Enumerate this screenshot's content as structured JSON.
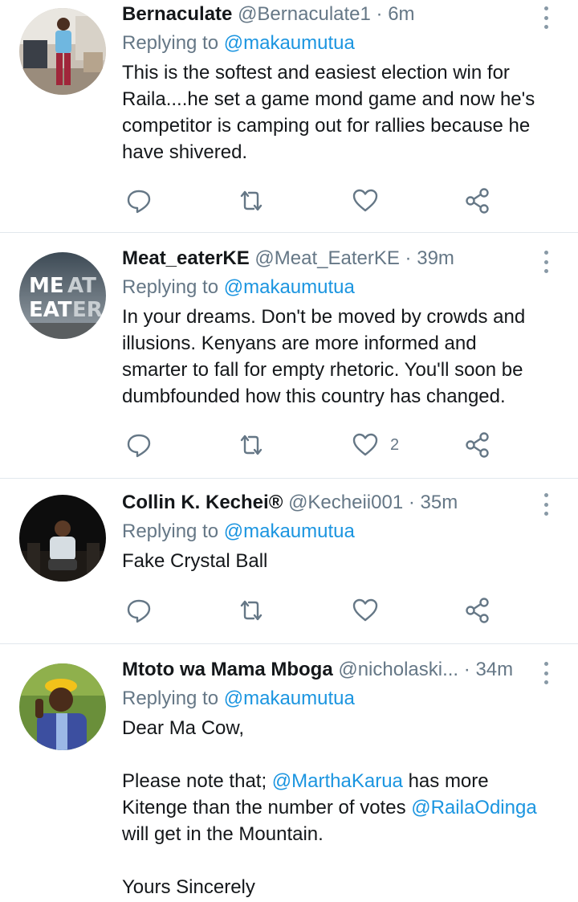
{
  "tweets": [
    {
      "name": "Bernaculate",
      "handle": "@Bernaculate1",
      "separator": "·",
      "time": "6m",
      "replying_prefix": "Replying to",
      "replying_to": "@makaumutua",
      "lines": [
        "This is the softest and easiest election win for",
        "Raila....he set a game mond game and now he's",
        "competitor is camping out for rallies because he",
        "have shivered."
      ],
      "likes": "",
      "icons": {
        "reply": "reply-icon",
        "retweet": "retweet-icon",
        "like": "heart-icon",
        "share": "share-icon",
        "more": "more-vertical-icon"
      }
    },
    {
      "name": "Meat_eaterKE",
      "handle": "@Meat_EaterKE",
      "separator": "·",
      "time": "39m",
      "replying_prefix": "Replying to",
      "replying_to": "@makaumutua",
      "lines": [
        "In your dreams. Don't be moved by crowds and",
        "illusions. Kenyans are more informed and",
        "smarter to fall for empty rhetoric. You'll soon be",
        "dumbfounded how this country has changed."
      ],
      "likes": "2",
      "avatar_text": [
        "ME",
        "AT",
        "EAT",
        "ER"
      ]
    },
    {
      "name": "Collin K. Kechei®",
      "handle": "@Kecheii001",
      "separator": "·",
      "time": "35m",
      "replying_prefix": "Replying to",
      "replying_to": "@makaumutua",
      "lines": [
        "Fake Crystal Ball"
      ],
      "likes": ""
    },
    {
      "name": "Mtoto wa Mama Mboga",
      "handle": "@nicholaski...",
      "separator": "·",
      "time": "34m",
      "replying_prefix": "Replying to",
      "replying_to": "@makaumutua",
      "greeting": "Dear Ma Cow,",
      "p2_a": "Please note that; ",
      "p2_mention1": "@MarthaKarua",
      "p2_b": " has more",
      "p2_c": "Kitenge than the number of votes ",
      "p2_mention2": "@RailaOdinga",
      "p2_d": "will get in the Mountain.",
      "closing": "Yours Sincerely"
    }
  ],
  "colors": {
    "link": "#1b95e0",
    "muted": "#657786",
    "divider": "#e1e8ed",
    "text": "#14171a"
  }
}
